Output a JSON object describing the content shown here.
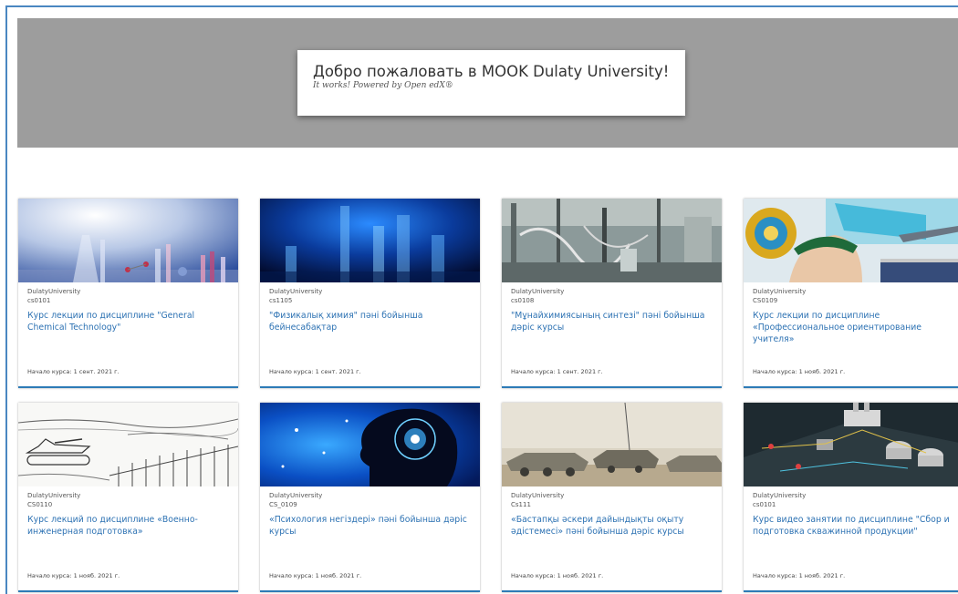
{
  "hero": {
    "title": "Добро пожаловать в MOOK Dulaty University!",
    "subtitle": "It works! Powered by Open edX®"
  },
  "colors": {
    "accent": "#2d72b3",
    "hero_background": "#9d9d9d",
    "card_border": "#2d7bb6"
  },
  "courses": [
    {
      "org": "DulatyUniversity",
      "code": "cs0101",
      "title": "Курс лекции по дисциплине \"General Chemical Technology\"",
      "start": "Начало курса: 1 сент. 2021 г.",
      "image": "lab-glassware-image"
    },
    {
      "org": "DulatyUniversity",
      "code": "cs1105",
      "title": "\"Физикалық химия\" пәні бойынша бейнесабақтар",
      "start": "Начало курса: 1 сент. 2021 г.",
      "image": "test-tubes-image"
    },
    {
      "org": "DulatyUniversity",
      "code": "cs0108",
      "title": "\"Мұнайхимиясының синтезі\" пәні бойынша дәріс курсы",
      "start": "Начало курса: 1 сент. 2021 г.",
      "image": "chemistry-lab-image"
    },
    {
      "org": "DulatyUniversity",
      "code": "CS0109",
      "title": "Курс лекции по дисциплине «Профессиональное ориентирование учителя»",
      "start": "Начало курса: 1 нояб. 2021 г.",
      "image": "military-emblem-image"
    },
    {
      "org": "DulatyUniversity",
      "code": "CS0110",
      "title": "Курс лекций по дисциплине «Военно-инженерная подготовка»",
      "start": "Начало курса: 1 нояб. 2021 г.",
      "image": "tank-sketch-image"
    },
    {
      "org": "DulatyUniversity",
      "code": "CS_0109",
      "title": "«Психология негіздері» пәні бойынша дәріс курсы",
      "start": "Начало курса: 1 нояб. 2021 г.",
      "image": "brain-head-image"
    },
    {
      "org": "DulatyUniversity",
      "code": "Cs111",
      "title": "«Бастапқы әскери дайындықты оқыту әдістемесі» пәні бойынша дәріс курсы",
      "start": "Начало курса: 1 нояб. 2021 г.",
      "image": "armored-vehicles-image"
    },
    {
      "org": "DulatyUniversity",
      "code": "cs0101",
      "title": "Курс видео занятии по дисциплине \"Сбор и подготовка скважинной продукции\"",
      "start": "Начало курса: 1 нояб. 2021 г.",
      "image": "plant-3d-model-image"
    }
  ]
}
